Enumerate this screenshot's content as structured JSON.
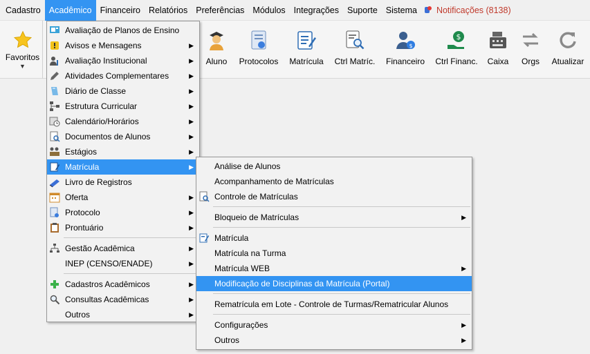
{
  "menubar": {
    "items": [
      "Cadastro",
      "Acadêmico",
      "Financeiro",
      "Relatórios",
      "Preferências",
      "Módulos",
      "Integrações",
      "Suporte",
      "Sistema"
    ],
    "notifications": "Notificações (8138)"
  },
  "toolbar": {
    "favorites": "Favoritos",
    "buttons": [
      "Aluno",
      "Protocolos",
      "Matrícula",
      "Ctrl Matríc.",
      "Financeiro",
      "Ctrl Financ.",
      "Caixa",
      "Orgs",
      "Atualizar"
    ]
  },
  "academico_menu": {
    "items": [
      "Avaliação de Planos de Ensino",
      "Avisos e Mensagens",
      "Avaliação Institucional",
      "Atividades Complementares",
      "Diário de Classe",
      "Estrutura Curricular",
      "Calendário/Horários",
      "Documentos de Alunos",
      "Estágios",
      "Matrícula",
      "Livro de Registros",
      "Oferta",
      "Protocolo",
      "Prontuário",
      "Gestão Acadêmica",
      "INEP (CENSO/ENADE)",
      "Cadastros Acadêmicos",
      "Consultas Acadêmicas",
      "Outros"
    ]
  },
  "matricula_menu": {
    "items": [
      "Análise de Alunos",
      "Acompanhamento de Matrículas",
      "Controle de Matrículas",
      "Bloqueio de Matrículas",
      "Matrícula",
      "Matrícula na Turma",
      "Matrícula WEB",
      "Modificação de Disciplinas da Matrícula (Portal)",
      "Rematrícula em Lote - Controle de Turmas/Rematricular Alunos",
      "Configurações",
      "Outros"
    ]
  },
  "colors": {
    "highlight": "#3394f2",
    "notification": "#c0392b"
  }
}
